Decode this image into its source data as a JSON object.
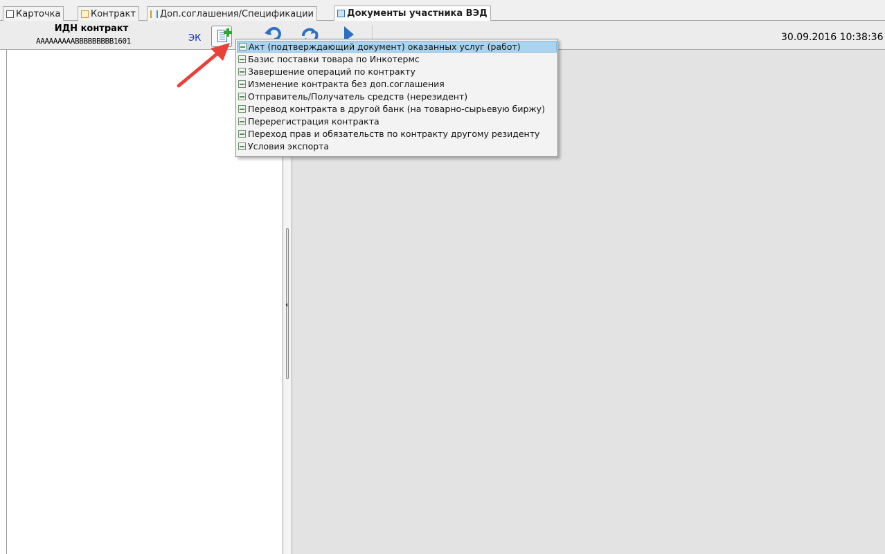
{
  "tabs": [
    {
      "label": "Карточка",
      "icon": "checklist-icon"
    },
    {
      "label": "Контракт",
      "icon": "contract-icon"
    },
    {
      "label": "Доп.соглашения/Спецификации",
      "icon": "chart-icon"
    },
    {
      "label": "Документы участника ВЭД",
      "icon": "documents-icon",
      "active": true
    }
  ],
  "header": {
    "id_title": "ИДН контракт",
    "id_value": "AAAAAAAAABBBBBBBBB1601",
    "ek_label": "ЭК",
    "datetime": "30.09.2016 10:38:36"
  },
  "menu": {
    "items": [
      "Акт (подтверждающий документ) оказанных услуг (работ)",
      "Базис поставки товара по Инкотермс",
      "Завершение операций по контракту",
      "Изменение контракта без доп.соглашения",
      "Отправитель/Получатель средств (нерезидент)",
      "Перевод контракта в другой банк (на товарно-сырьевую биржу)",
      "Перерегистрация контракта",
      "Переход прав и обязательств по контракту другому резиденту",
      "Условия экспорта"
    ],
    "highlighted_index": 0
  },
  "colors": {
    "accent_blue": "#2d6fc2",
    "plus_green": "#2da82d",
    "highlight": "#a9d3ef",
    "annotation_arrow": "#e8413a"
  }
}
